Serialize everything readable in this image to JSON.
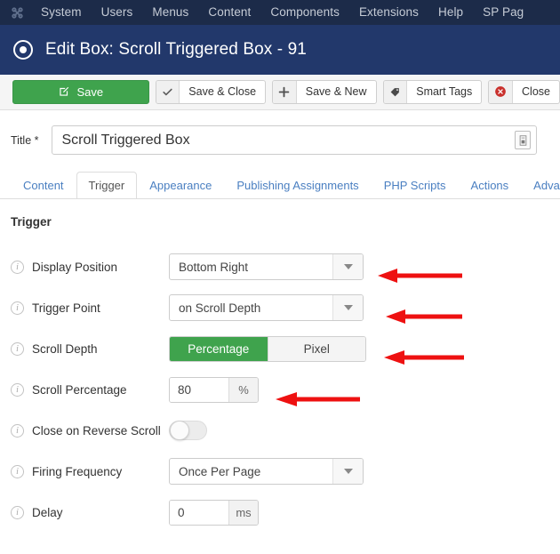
{
  "navbar": {
    "logo_icon": "joomla-logo-icon",
    "items": [
      {
        "label": "System"
      },
      {
        "label": "Users"
      },
      {
        "label": "Menus"
      },
      {
        "label": "Content"
      },
      {
        "label": "Components"
      },
      {
        "label": "Extensions"
      },
      {
        "label": "Help"
      },
      {
        "label": "SP Pag"
      }
    ]
  },
  "header": {
    "icon": "target-circle-icon",
    "title": "Edit Box: Scroll Triggered Box - 91"
  },
  "toolbar": {
    "save_label": "Save",
    "save_icon": "pencil-square-icon",
    "save_close_label": "Save & Close",
    "save_close_icon": "check-icon",
    "save_new_label": "Save & New",
    "save_new_icon": "plus-icon",
    "smart_tags_label": "Smart Tags",
    "smart_tags_icon": "tag-icon",
    "close_label": "Close",
    "close_icon": "circle-x-icon"
  },
  "title_field": {
    "label": "Title *",
    "value": "Scroll Triggered Box",
    "placeholder": "",
    "button_icon": "article-icon"
  },
  "tabs": [
    {
      "label": "Content",
      "active": false
    },
    {
      "label": "Trigger",
      "active": true
    },
    {
      "label": "Appearance",
      "active": false
    },
    {
      "label": "Publishing Assignments",
      "active": false
    },
    {
      "label": "PHP Scripts",
      "active": false
    },
    {
      "label": "Actions",
      "active": false
    },
    {
      "label": "Adva",
      "active": false
    }
  ],
  "form": {
    "section_title": "Trigger",
    "display_position": {
      "label": "Display Position",
      "value": "Bottom Right",
      "caret_icon": "chevron-down-icon"
    },
    "trigger_point": {
      "label": "Trigger Point",
      "value": "on Scroll Depth",
      "caret_icon": "chevron-down-icon"
    },
    "scroll_depth": {
      "label": "Scroll Depth",
      "option_a": "Percentage",
      "option_b": "Pixel",
      "selected": "Percentage"
    },
    "scroll_percentage": {
      "label": "Scroll Percentage",
      "value": "80",
      "unit": "%"
    },
    "close_on_reverse_scroll": {
      "label": "Close on Reverse Scroll",
      "state": "off"
    },
    "firing_frequency": {
      "label": "Firing Frequency",
      "value": "Once Per Page",
      "caret_icon": "chevron-down-icon"
    },
    "delay": {
      "label": "Delay",
      "value": "0",
      "unit": "ms"
    }
  },
  "annotations": {
    "arrow_color": "#ee1111",
    "arrows": [
      {
        "target": "display-position"
      },
      {
        "target": "trigger-point"
      },
      {
        "target": "scroll-depth"
      },
      {
        "target": "scroll-percentage"
      }
    ]
  },
  "colors": {
    "navbar_bg": "#1c2b49",
    "header_bg": "#22386b",
    "primary_green": "#3fa34d",
    "link_blue": "#4a7fc1",
    "danger_red": "#c9302c"
  }
}
